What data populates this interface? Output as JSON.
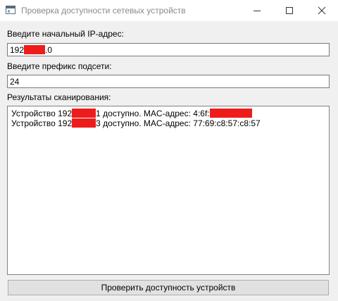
{
  "window": {
    "title": "Проверка доступности сетевых устройств",
    "icon": "app-window-icon",
    "controls": [
      "minimize-icon",
      "maximize-icon",
      "close-icon"
    ]
  },
  "ip": {
    "label": "Введите начальный IP-адрес:",
    "value_start": "192",
    "value_end": ".0"
  },
  "prefix": {
    "label": "Введите префикс подсети:",
    "value": "24"
  },
  "results": {
    "label": "Результаты сканирования:",
    "rows": [
      {
        "prefix": "Устройство 192",
        "suffix": "1 доступно. MAC-адрес:   4:6f:"
      },
      {
        "prefix": "Устройство 192",
        "suffix": "3 доступно. MAC-адрес: 77:69:c8:57:c8:57"
      }
    ]
  },
  "scan_button_label": "Проверить доступность устройств",
  "colors": {
    "redaction": "#ef1c1c"
  }
}
